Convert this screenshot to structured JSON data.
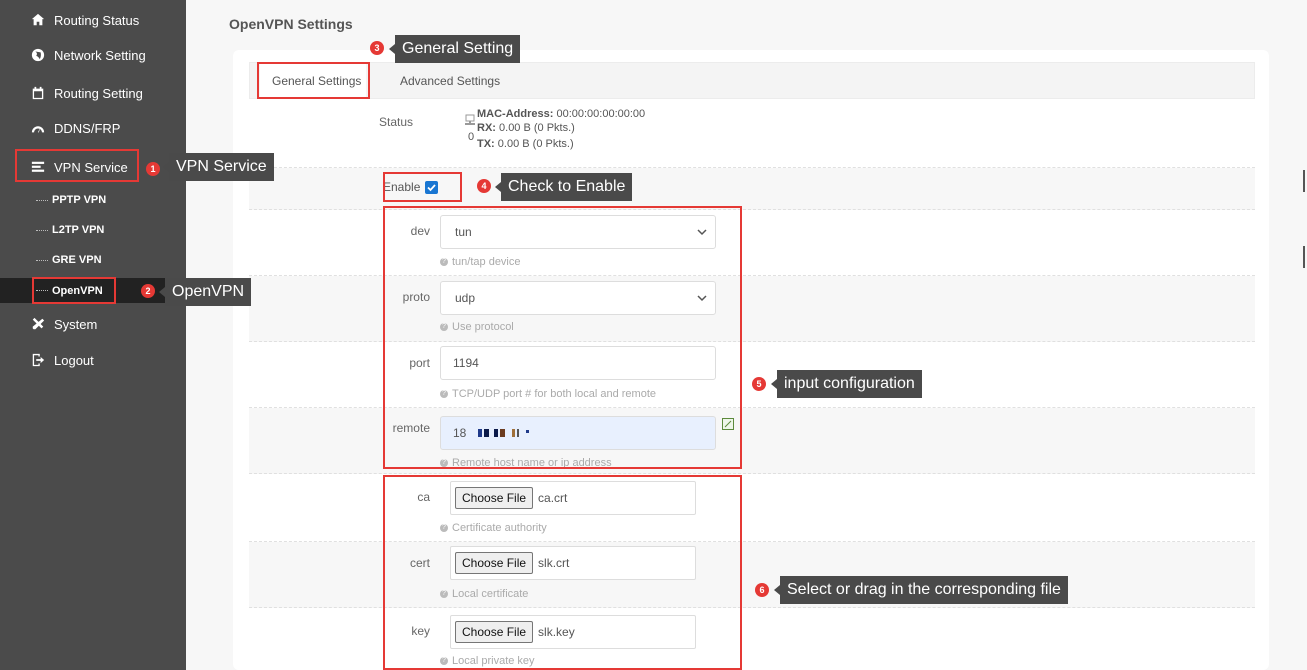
{
  "sidebar": {
    "items": [
      {
        "label": "Routing Status",
        "icon": "home-icon"
      },
      {
        "label": "Network Setting",
        "icon": "globe-icon"
      },
      {
        "label": "Routing Setting",
        "icon": "calendar-icon"
      },
      {
        "label": "DDNS/FRP",
        "icon": "gauge-icon"
      },
      {
        "label": "VPN Service",
        "icon": "list-icon"
      },
      {
        "label": "System",
        "icon": "tools-icon"
      },
      {
        "label": "Logout",
        "icon": "logout-icon"
      }
    ],
    "vpn_sub": [
      "PPTP VPN",
      "L2TP VPN",
      "GRE VPN",
      "OpenVPN"
    ]
  },
  "page": {
    "title": "OpenVPN Settings"
  },
  "tabs": [
    "General Settings",
    "Advanced Settings"
  ],
  "status": {
    "label": "Status",
    "count": "0",
    "mac_label": "MAC-Address:",
    "mac_value": "00:00:00:00:00:00",
    "rx_label": "RX:",
    "rx_value": "0.00 B (0 Pkts.)",
    "tx_label": "TX:",
    "tx_value": "0.00 B (0 Pkts.)"
  },
  "enable": {
    "label": "Enable",
    "checked": true
  },
  "fields": {
    "dev": {
      "label": "dev",
      "value": "tun",
      "hint": "tun/tap device"
    },
    "proto": {
      "label": "proto",
      "value": "udp",
      "hint": "Use protocol"
    },
    "port": {
      "label": "port",
      "value": "1194",
      "hint": "TCP/UDP port # for both local and remote"
    },
    "remote": {
      "label": "remote",
      "value": "18",
      "hint": "Remote host name or ip address"
    },
    "ca": {
      "label": "ca",
      "button": "Choose File",
      "file": "ca.crt",
      "hint": "Certificate authority"
    },
    "cert": {
      "label": "cert",
      "button": "Choose File",
      "file": "slk.crt",
      "hint": "Local certificate"
    },
    "key": {
      "label": "key",
      "button": "Choose File",
      "file": "slk.key",
      "hint": "Local private key"
    }
  },
  "annotations": [
    {
      "num": "1",
      "text": "VPN Service"
    },
    {
      "num": "2",
      "text": "OpenVPN"
    },
    {
      "num": "3",
      "text": "General Setting"
    },
    {
      "num": "4",
      "text": "Check to Enable"
    },
    {
      "num": "5",
      "text": "input configuration"
    },
    {
      "num": "6",
      "text": "Select or drag in the corresponding file"
    }
  ],
  "colors": {
    "sidebar": "#4b4b4b",
    "annotation": "#e53935",
    "callout": "#4a4a4a"
  }
}
